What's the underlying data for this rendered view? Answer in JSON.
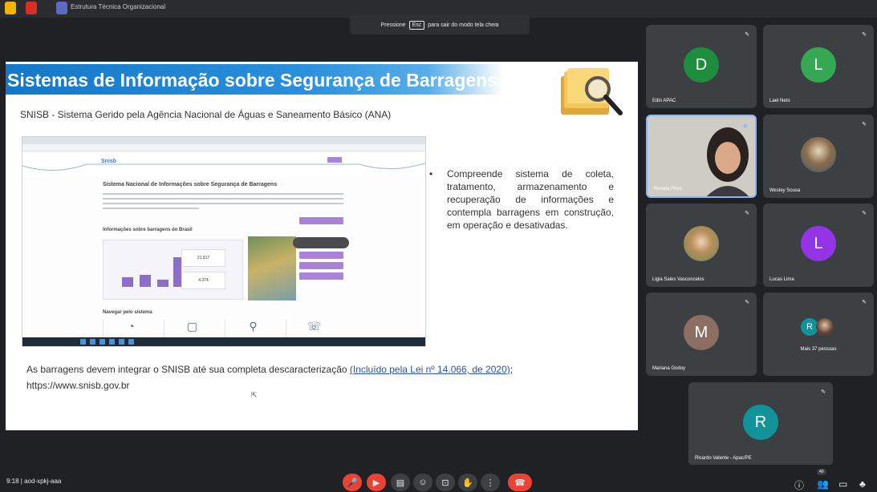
{
  "top_bar": {
    "window_title": "Estrutura Técnica Organizacional",
    "esc_hint": {
      "before": "Pressione",
      "key": "Esc",
      "after": "para sair do modo tela cheia"
    }
  },
  "slide": {
    "title": "Sistemas de Informação sobre Segurança de Barragens",
    "subtitle": "SNISB - Sistema Gerido pela Agência Nacional de Águas e Saneamento Básico (ANA)",
    "bullet": "Compreende sistema de coleta, tratamento, armazenamento e recuperação de informações e contempla barragens em construção, em operação e desativadas.",
    "footer_text": "As barragens devem integrar o SNISB até sua completa descaracterização",
    "footer_link": "(Incluído pela Lei nº 14.066, de 2020)",
    "footer_link_suffix": ";",
    "footer_url": "https://www.snisb.gov.br",
    "embedded_site": {
      "logo": "Snisb",
      "heading": "Sistema Nacional de Informações sobre Segurança de Barragens",
      "section_info": "Informações sobre barragens do Brasil",
      "stat_1": "21.917",
      "stat_2": "4.374",
      "section_nav": "Navegar pelo sistema"
    }
  },
  "participants": [
    {
      "name": "Edin APAC",
      "initial": "D",
      "color": "#1e8e3e"
    },
    {
      "name": "Lael Neto",
      "initial": "L",
      "color": "#34a853"
    },
    {
      "name": "Renata Pires",
      "initial": "",
      "color": ""
    },
    {
      "name": "Wesley Sousa",
      "initial": "",
      "color": ""
    },
    {
      "name": "Ligia Sales Vasconcelos",
      "initial": "",
      "color": ""
    },
    {
      "name": "Lucas Lima",
      "initial": "L",
      "color": "#9334e6"
    },
    {
      "name": "Mariana Godoy",
      "initial": "M",
      "color": "#8d6e63"
    },
    {
      "name": "Mais 37 pessoas",
      "initial": "R",
      "color": "#12939a"
    },
    {
      "name": "Ricardo Valente - Apac/PE",
      "initial": "R",
      "color": "#12939a"
    }
  ],
  "bottom_bar": {
    "meeting_code": "9:18 | aod-xpkj-aaa",
    "participant_count": "40"
  },
  "colors": {
    "background": "#202124",
    "tile": "#3c4043",
    "title_bar": "#1478c8",
    "end_call": "#ea4335"
  }
}
